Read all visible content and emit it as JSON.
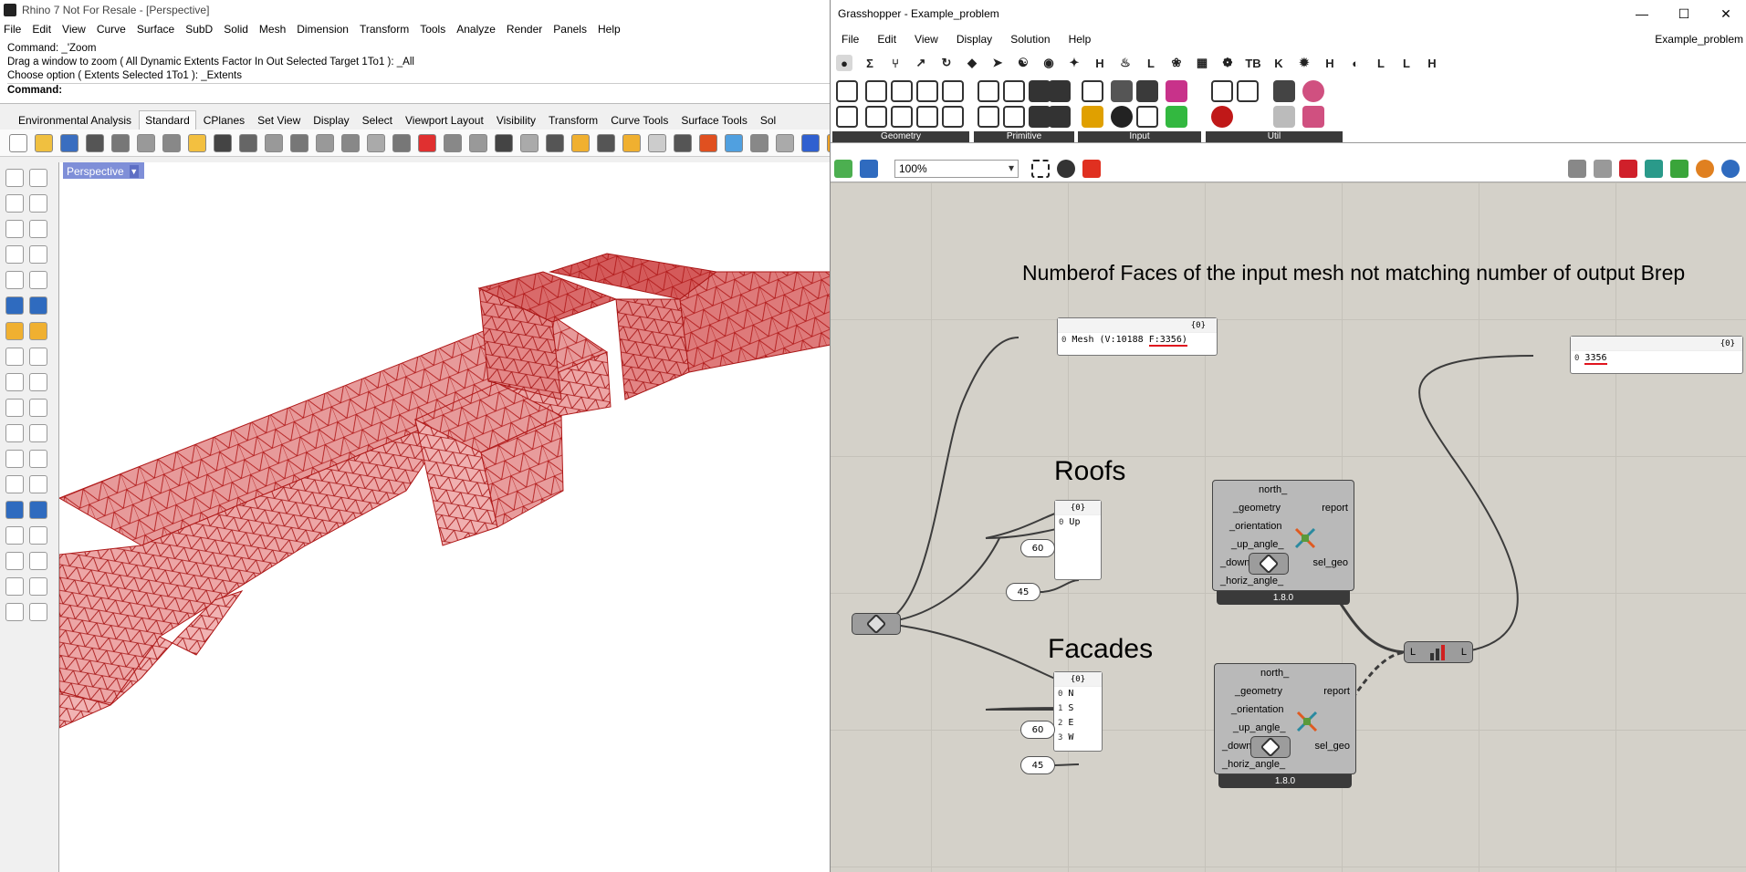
{
  "rhino": {
    "title": "Rhino 7 Not For Resale - [Perspective]",
    "menu": [
      "File",
      "Edit",
      "View",
      "Curve",
      "Surface",
      "SubD",
      "Solid",
      "Mesh",
      "Dimension",
      "Transform",
      "Tools",
      "Analyze",
      "Render",
      "Panels",
      "Help"
    ],
    "command_history": [
      "Command: _'Zoom",
      "Drag a window to zoom ( All  Dynamic  Extents  Factor  In  Out  Selected  Target  1To1 ): _All",
      "Choose option ( Extents  Selected  1To1 ): _Extents"
    ],
    "command_prompt": "Command:",
    "toolbar_tabs": [
      "Environmental Analysis",
      "Standard",
      "CPlanes",
      "Set View",
      "Display",
      "Select",
      "Viewport Layout",
      "Visibility",
      "Transform",
      "Curve Tools",
      "Surface Tools",
      "Sol"
    ],
    "active_tab": "Standard",
    "viewport_label": "Perspective",
    "mesh_color": "#c81e1e"
  },
  "gh": {
    "title": "Grasshopper - Example_problem",
    "window_controls": [
      "—",
      "☐",
      "✕"
    ],
    "menu": [
      "File",
      "Edit",
      "View",
      "Display",
      "Solution",
      "Help"
    ],
    "doc_name": "Example_problem",
    "tabs": [
      "●",
      "Σ",
      "⑂",
      "↗",
      "↻",
      "◆",
      "➤",
      "☯",
      "◉",
      "✦",
      "H",
      "♨",
      "L",
      "❀",
      "▦",
      "❁",
      "TB",
      "K",
      "✹",
      "H",
      "◐",
      "L",
      "L",
      "H"
    ],
    "palette_groups": [
      "Geometry",
      "Primitive",
      "Input",
      "Util"
    ],
    "zoom": "100%",
    "heading": "Numberof Faces of the input mesh not matching number of output Brep",
    "label_roofs": "Roofs",
    "label_facades": "Facades",
    "mesh_panel": {
      "path": "{0}",
      "index": "0",
      "text_a": "Mesh (V:10188 ",
      "text_b": "F:3356)"
    },
    "count_panel": {
      "path": "{0}",
      "index": "0",
      "value": "3356"
    },
    "roofs_panel": {
      "path": "{0}",
      "rows": [
        {
          "i": "0",
          "v": "Up"
        }
      ]
    },
    "facades_panel": {
      "path": "{0}",
      "rows": [
        {
          "i": "0",
          "v": "N"
        },
        {
          "i": "1",
          "v": "S"
        },
        {
          "i": "2",
          "v": "E"
        },
        {
          "i": "3",
          "v": "W"
        }
      ]
    },
    "component": {
      "inputs": [
        "north_",
        "_geometry",
        "_orientation",
        "_up_angle_",
        "_down_angle_",
        "_horiz_angle_"
      ],
      "output_report": "report",
      "output_sel_geo": "sel_geo",
      "version": "1.8.0"
    },
    "roofs_up_angle": "60",
    "roofs_horiz_angle": "45",
    "facades_up_angle": "60",
    "facades_horiz_angle": "45",
    "merge_port_left": "L",
    "merge_port_right": "L",
    "wire_color": "#3c3c3c",
    "underline_color": "#e0141e"
  }
}
